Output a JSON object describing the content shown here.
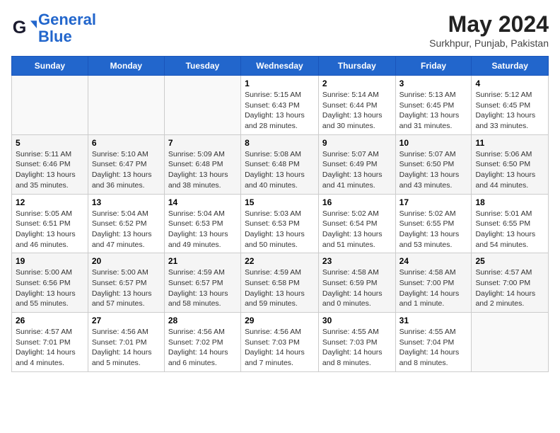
{
  "logo": {
    "line1": "General",
    "line2": "Blue"
  },
  "title": "May 2024",
  "subtitle": "Surkhpur, Punjab, Pakistan",
  "days_of_week": [
    "Sunday",
    "Monday",
    "Tuesday",
    "Wednesday",
    "Thursday",
    "Friday",
    "Saturday"
  ],
  "weeks": [
    [
      {
        "day": "",
        "info": ""
      },
      {
        "day": "",
        "info": ""
      },
      {
        "day": "",
        "info": ""
      },
      {
        "day": "1",
        "info": "Sunrise: 5:15 AM\nSunset: 6:43 PM\nDaylight: 13 hours\nand 28 minutes."
      },
      {
        "day": "2",
        "info": "Sunrise: 5:14 AM\nSunset: 6:44 PM\nDaylight: 13 hours\nand 30 minutes."
      },
      {
        "day": "3",
        "info": "Sunrise: 5:13 AM\nSunset: 6:45 PM\nDaylight: 13 hours\nand 31 minutes."
      },
      {
        "day": "4",
        "info": "Sunrise: 5:12 AM\nSunset: 6:45 PM\nDaylight: 13 hours\nand 33 minutes."
      }
    ],
    [
      {
        "day": "5",
        "info": "Sunrise: 5:11 AM\nSunset: 6:46 PM\nDaylight: 13 hours\nand 35 minutes."
      },
      {
        "day": "6",
        "info": "Sunrise: 5:10 AM\nSunset: 6:47 PM\nDaylight: 13 hours\nand 36 minutes."
      },
      {
        "day": "7",
        "info": "Sunrise: 5:09 AM\nSunset: 6:48 PM\nDaylight: 13 hours\nand 38 minutes."
      },
      {
        "day": "8",
        "info": "Sunrise: 5:08 AM\nSunset: 6:48 PM\nDaylight: 13 hours\nand 40 minutes."
      },
      {
        "day": "9",
        "info": "Sunrise: 5:07 AM\nSunset: 6:49 PM\nDaylight: 13 hours\nand 41 minutes."
      },
      {
        "day": "10",
        "info": "Sunrise: 5:07 AM\nSunset: 6:50 PM\nDaylight: 13 hours\nand 43 minutes."
      },
      {
        "day": "11",
        "info": "Sunrise: 5:06 AM\nSunset: 6:50 PM\nDaylight: 13 hours\nand 44 minutes."
      }
    ],
    [
      {
        "day": "12",
        "info": "Sunrise: 5:05 AM\nSunset: 6:51 PM\nDaylight: 13 hours\nand 46 minutes."
      },
      {
        "day": "13",
        "info": "Sunrise: 5:04 AM\nSunset: 6:52 PM\nDaylight: 13 hours\nand 47 minutes."
      },
      {
        "day": "14",
        "info": "Sunrise: 5:04 AM\nSunset: 6:53 PM\nDaylight: 13 hours\nand 49 minutes."
      },
      {
        "day": "15",
        "info": "Sunrise: 5:03 AM\nSunset: 6:53 PM\nDaylight: 13 hours\nand 50 minutes."
      },
      {
        "day": "16",
        "info": "Sunrise: 5:02 AM\nSunset: 6:54 PM\nDaylight: 13 hours\nand 51 minutes."
      },
      {
        "day": "17",
        "info": "Sunrise: 5:02 AM\nSunset: 6:55 PM\nDaylight: 13 hours\nand 53 minutes."
      },
      {
        "day": "18",
        "info": "Sunrise: 5:01 AM\nSunset: 6:55 PM\nDaylight: 13 hours\nand 54 minutes."
      }
    ],
    [
      {
        "day": "19",
        "info": "Sunrise: 5:00 AM\nSunset: 6:56 PM\nDaylight: 13 hours\nand 55 minutes."
      },
      {
        "day": "20",
        "info": "Sunrise: 5:00 AM\nSunset: 6:57 PM\nDaylight: 13 hours\nand 57 minutes."
      },
      {
        "day": "21",
        "info": "Sunrise: 4:59 AM\nSunset: 6:57 PM\nDaylight: 13 hours\nand 58 minutes."
      },
      {
        "day": "22",
        "info": "Sunrise: 4:59 AM\nSunset: 6:58 PM\nDaylight: 13 hours\nand 59 minutes."
      },
      {
        "day": "23",
        "info": "Sunrise: 4:58 AM\nSunset: 6:59 PM\nDaylight: 14 hours\nand 0 minutes."
      },
      {
        "day": "24",
        "info": "Sunrise: 4:58 AM\nSunset: 7:00 PM\nDaylight: 14 hours\nand 1 minute."
      },
      {
        "day": "25",
        "info": "Sunrise: 4:57 AM\nSunset: 7:00 PM\nDaylight: 14 hours\nand 2 minutes."
      }
    ],
    [
      {
        "day": "26",
        "info": "Sunrise: 4:57 AM\nSunset: 7:01 PM\nDaylight: 14 hours\nand 4 minutes."
      },
      {
        "day": "27",
        "info": "Sunrise: 4:56 AM\nSunset: 7:01 PM\nDaylight: 14 hours\nand 5 minutes."
      },
      {
        "day": "28",
        "info": "Sunrise: 4:56 AM\nSunset: 7:02 PM\nDaylight: 14 hours\nand 6 minutes."
      },
      {
        "day": "29",
        "info": "Sunrise: 4:56 AM\nSunset: 7:03 PM\nDaylight: 14 hours\nand 7 minutes."
      },
      {
        "day": "30",
        "info": "Sunrise: 4:55 AM\nSunset: 7:03 PM\nDaylight: 14 hours\nand 8 minutes."
      },
      {
        "day": "31",
        "info": "Sunrise: 4:55 AM\nSunset: 7:04 PM\nDaylight: 14 hours\nand 8 minutes."
      },
      {
        "day": "",
        "info": ""
      }
    ]
  ]
}
